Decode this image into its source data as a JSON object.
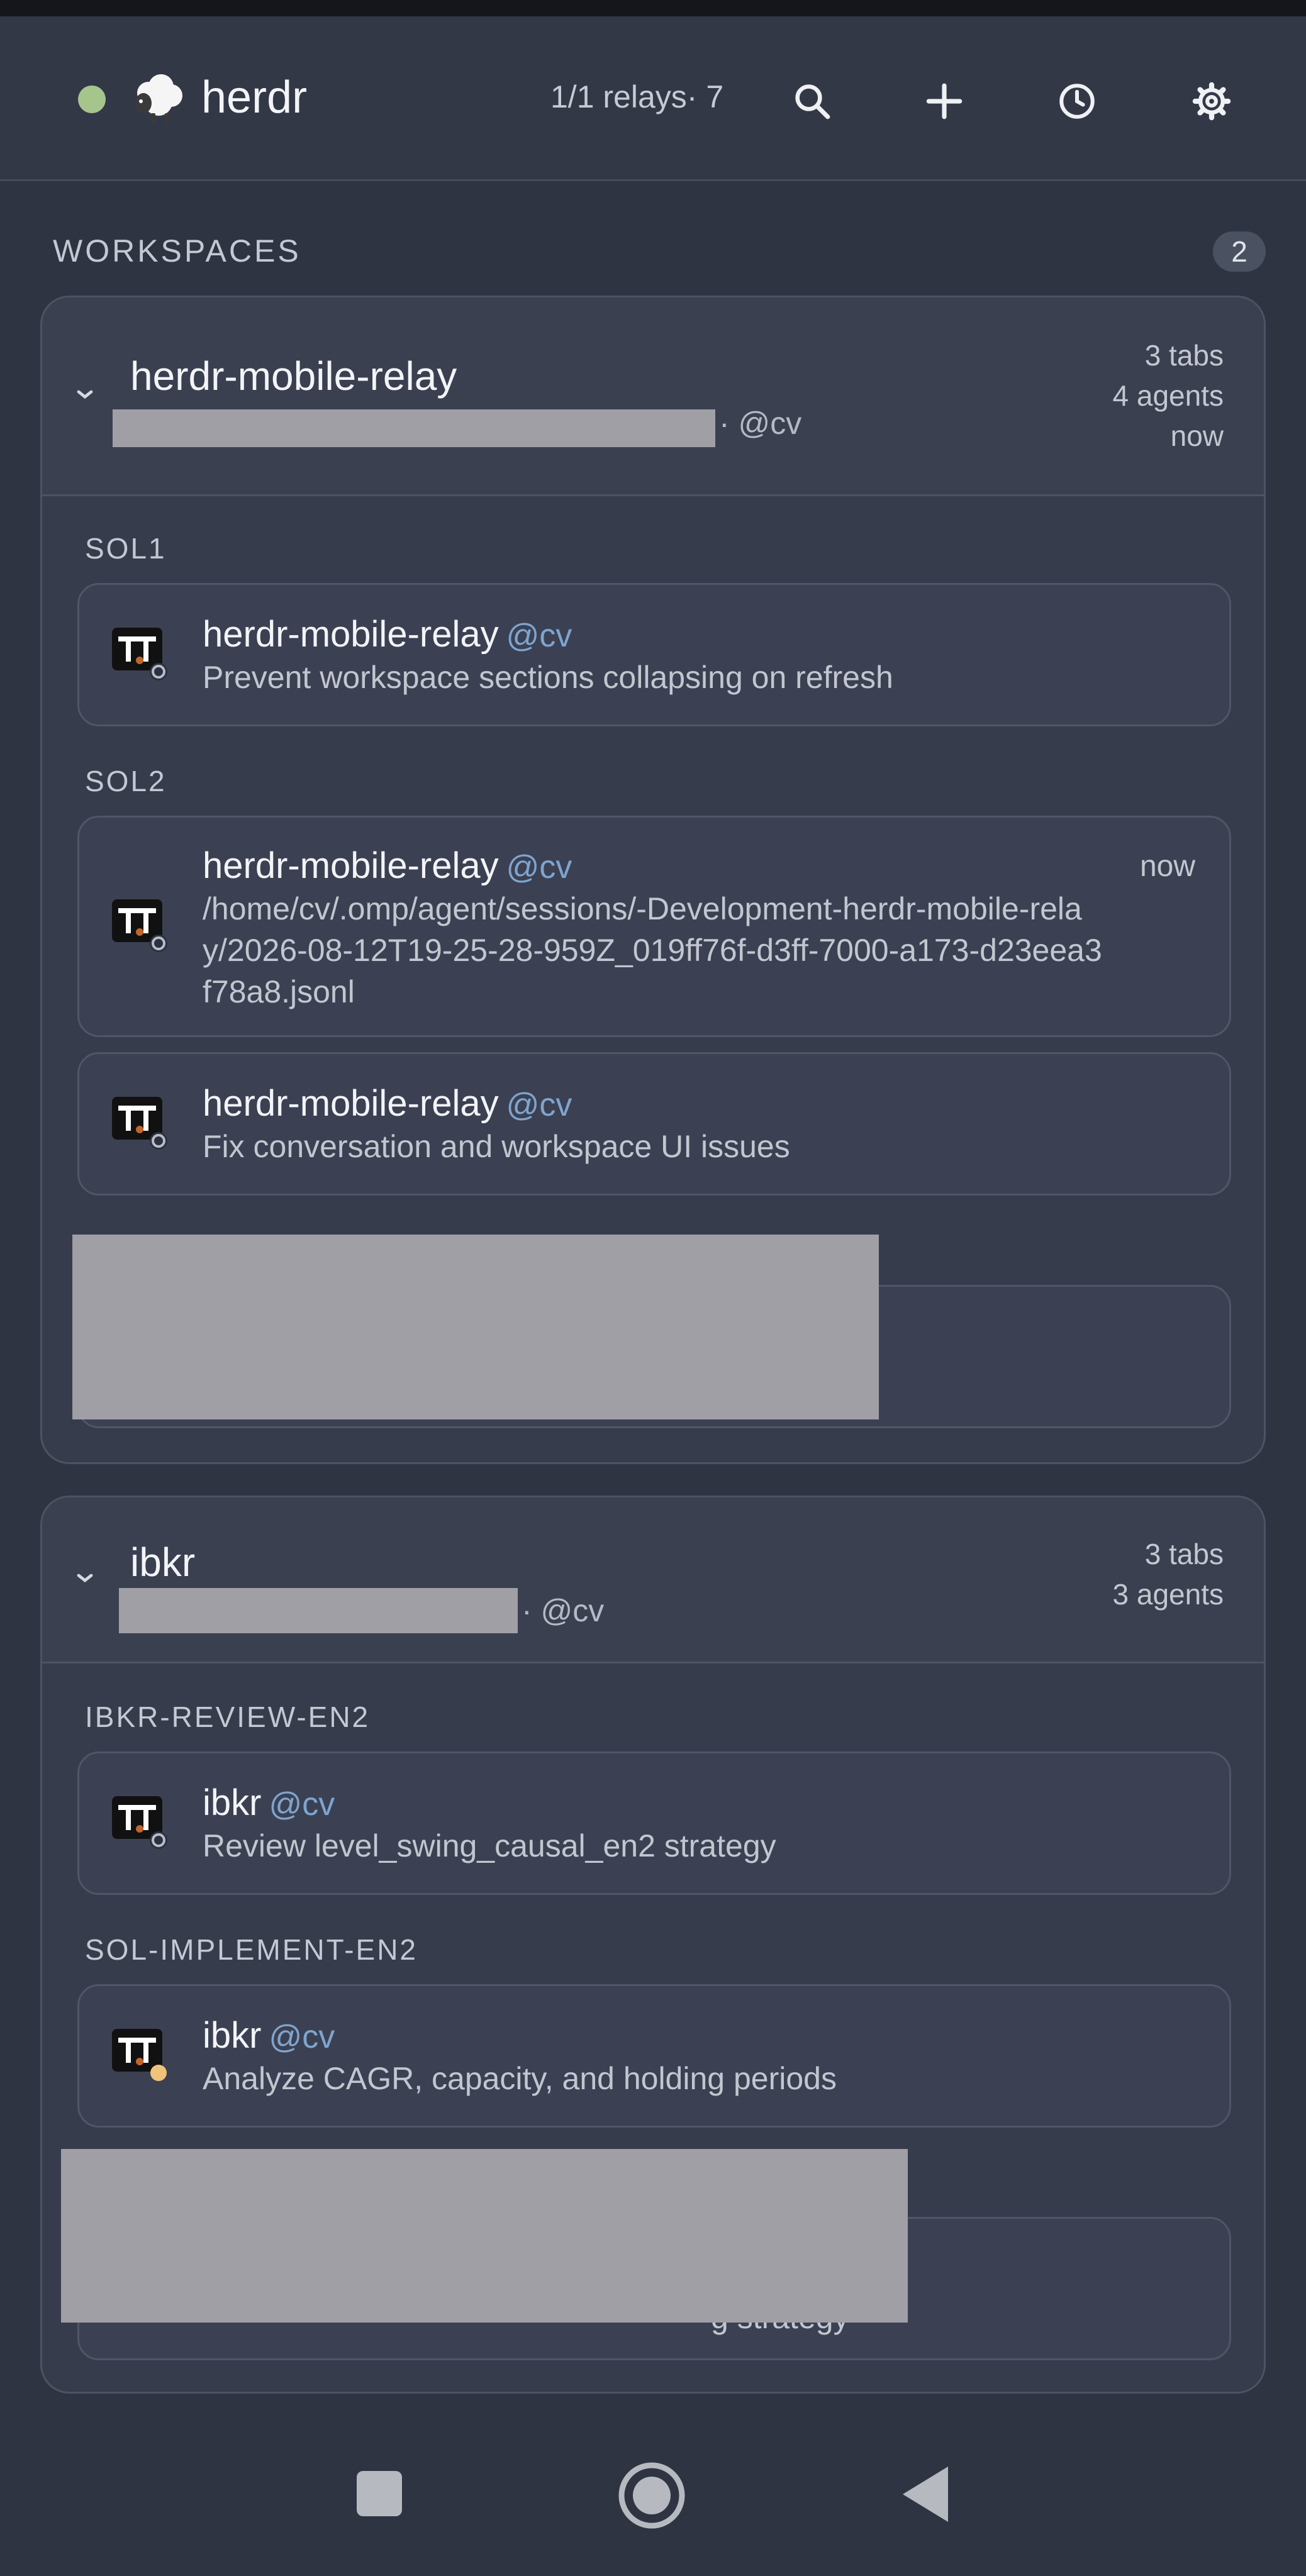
{
  "app": {
    "title": "herdr",
    "relay_status": "1/1 relays· 7",
    "status_color": "#a6c58d"
  },
  "toolbar": {
    "search_icon": "search-icon",
    "add_icon": "plus-icon",
    "history_icon": "clock-icon",
    "settings_icon": "gear-icon"
  },
  "workspaces": {
    "heading": "WORKSPACES",
    "count": "2",
    "items": [
      {
        "name": "herdr-mobile-relay",
        "owner": "· @cv",
        "tabs": "3 tabs",
        "agents": "4 agents",
        "updated": "now",
        "groups": [
          {
            "label": "SOL1",
            "cards": [
              {
                "title": "herdr-mobile-relay",
                "user": "@cv",
                "subtitle": "Prevent workspace sections collapsing on refresh",
                "time": ""
              }
            ]
          },
          {
            "label": "SOL2",
            "cards": [
              {
                "title": "herdr-mobile-relay",
                "user": "@cv",
                "subtitle": "/home/cv/.omp/agent/sessions/-Development-herdr-mobile-relay/2026-08-12T19-25-28-959Z_019ff76f-d3ff-7000-a173-d23eea3f78a8.jsonl",
                "time": "now"
              },
              {
                "title": "herdr-mobile-relay",
                "user": "@cv",
                "subtitle": "Fix conversation and workspace UI issues",
                "time": ""
              }
            ]
          }
        ]
      },
      {
        "name": "ibkr",
        "owner": "· @cv",
        "tabs": "3 tabs",
        "agents": "3 agents",
        "updated": "",
        "groups": [
          {
            "label": "IBKR-REVIEW-EN2",
            "cards": [
              {
                "title": "ibkr",
                "user": "@cv",
                "subtitle": "Review level_swing_causal_en2 strategy",
                "time": ""
              }
            ]
          },
          {
            "label": "SOL-IMPLEMENT-EN2",
            "cards": [
              {
                "title": "ibkr",
                "user": "@cv",
                "subtitle": "Analyze CAGR, capacity, and holding periods",
                "time": ""
              }
            ]
          }
        ],
        "partial_text": "g strategy"
      }
    ]
  },
  "status_colors": {
    "idle": "#b8bcc6",
    "working": "#f0c27a"
  },
  "nav": {
    "recents": "square-icon",
    "home": "circle-icon",
    "back": "triangle-back-icon"
  }
}
